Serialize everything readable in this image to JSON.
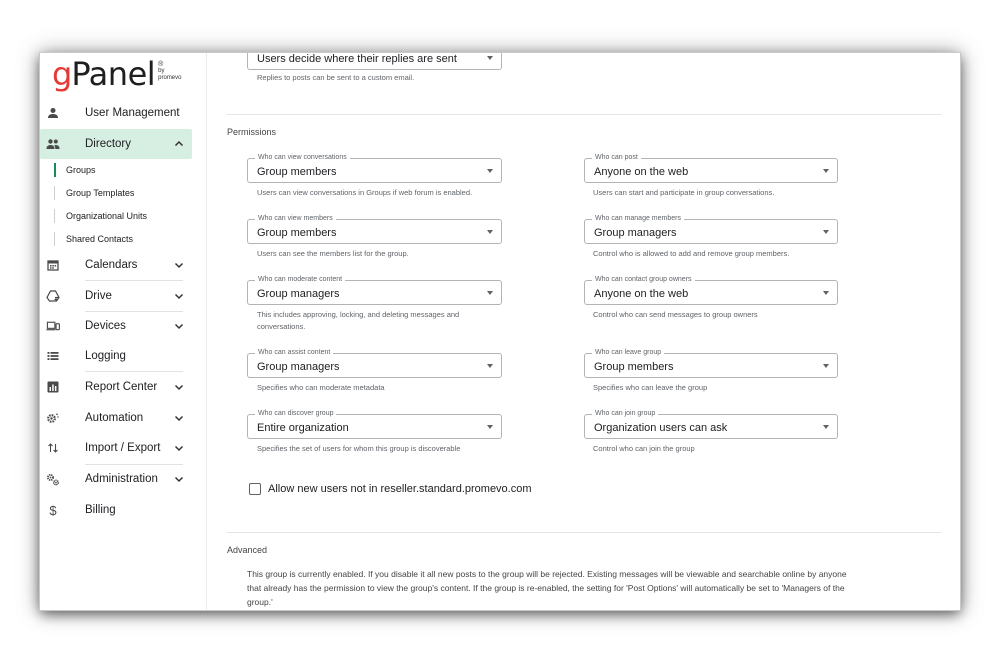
{
  "brand": {
    "logo_g": "g",
    "logo_panel": "Panel",
    "logo_reg": "®",
    "logo_by": "by",
    "logo_company": "promevo"
  },
  "sidebar": {
    "items": [
      {
        "label": "User Management",
        "icon": "person-icon"
      },
      {
        "label": "Directory",
        "icon": "people-icon"
      },
      {
        "label": "Calendars",
        "icon": "calendar-icon"
      },
      {
        "label": "Drive",
        "icon": "drive-icon"
      },
      {
        "label": "Devices",
        "icon": "devices-icon"
      },
      {
        "label": "Logging",
        "icon": "list-icon"
      },
      {
        "label": "Report Center",
        "icon": "report-icon"
      },
      {
        "label": "Automation",
        "icon": "automation-gear-icon"
      },
      {
        "label": "Import / Export",
        "icon": "import-export-icon"
      },
      {
        "label": "Administration",
        "icon": "admin-gears-icon"
      },
      {
        "label": "Billing",
        "icon": "dollar-icon"
      }
    ],
    "directory_sub": [
      {
        "label": "Groups"
      },
      {
        "label": "Group Templates"
      },
      {
        "label": "Organizational Units"
      },
      {
        "label": "Shared Contacts"
      }
    ]
  },
  "top_partial": {
    "select_value": "Users decide where their replies are sent",
    "helper": "Replies to posts can be sent to a custom email."
  },
  "permissions": {
    "title": "Permissions",
    "fields": [
      {
        "legend": "Who can view conversations",
        "value": "Group members",
        "helper": "Users can view conversations in Groups if web forum is enabled."
      },
      {
        "legend": "Who can post",
        "value": "Anyone on the web",
        "helper": "Users can start and participate in group conversations."
      },
      {
        "legend": "Who can view members",
        "value": "Group members",
        "helper": "Users can see the members list for the group."
      },
      {
        "legend": "Who can manage members",
        "value": "Group managers",
        "helper": "Control who is allowed to add and remove group members."
      },
      {
        "legend": "Who can moderate content",
        "value": "Group managers",
        "helper": "This includes approving, locking, and deleting messages and",
        "helper2": "conversations."
      },
      {
        "legend": "Who can contact group owners",
        "value": "Anyone on the web",
        "helper": "Control who can send messages to group owners"
      },
      {
        "legend": "Who can assist content",
        "value": "Group managers",
        "helper": "Specifies who can moderate metadata"
      },
      {
        "legend": "Who can leave group",
        "value": "Group members",
        "helper": "Specifies who can leave the group"
      },
      {
        "legend": "Who can discover group",
        "value": "Entire organization",
        "helper": "Specifies the set of users for whom this group is discoverable"
      },
      {
        "legend": "Who can join group",
        "value": "Organization users can ask",
        "helper": "Control who can join the group"
      }
    ],
    "allow_external_label": "Allow new users not in reseller.standard.promevo.com",
    "allow_external_checked": false
  },
  "advanced": {
    "title": "Advanced",
    "line1": "This group is currently enabled. If you disable it all new posts to the group will be rejected. Existing messages will be viewable and searchable online by anyone",
    "line2": "that already has the permission to view the group's content. If the group is re-enabled, the setting for 'Post Options' will automatically be set to 'Managers of the",
    "line3": "group.'"
  },
  "colors": {
    "accent": "#1a8a5a",
    "active_bg": "#d7eee2",
    "logo_red": "#e53935"
  }
}
